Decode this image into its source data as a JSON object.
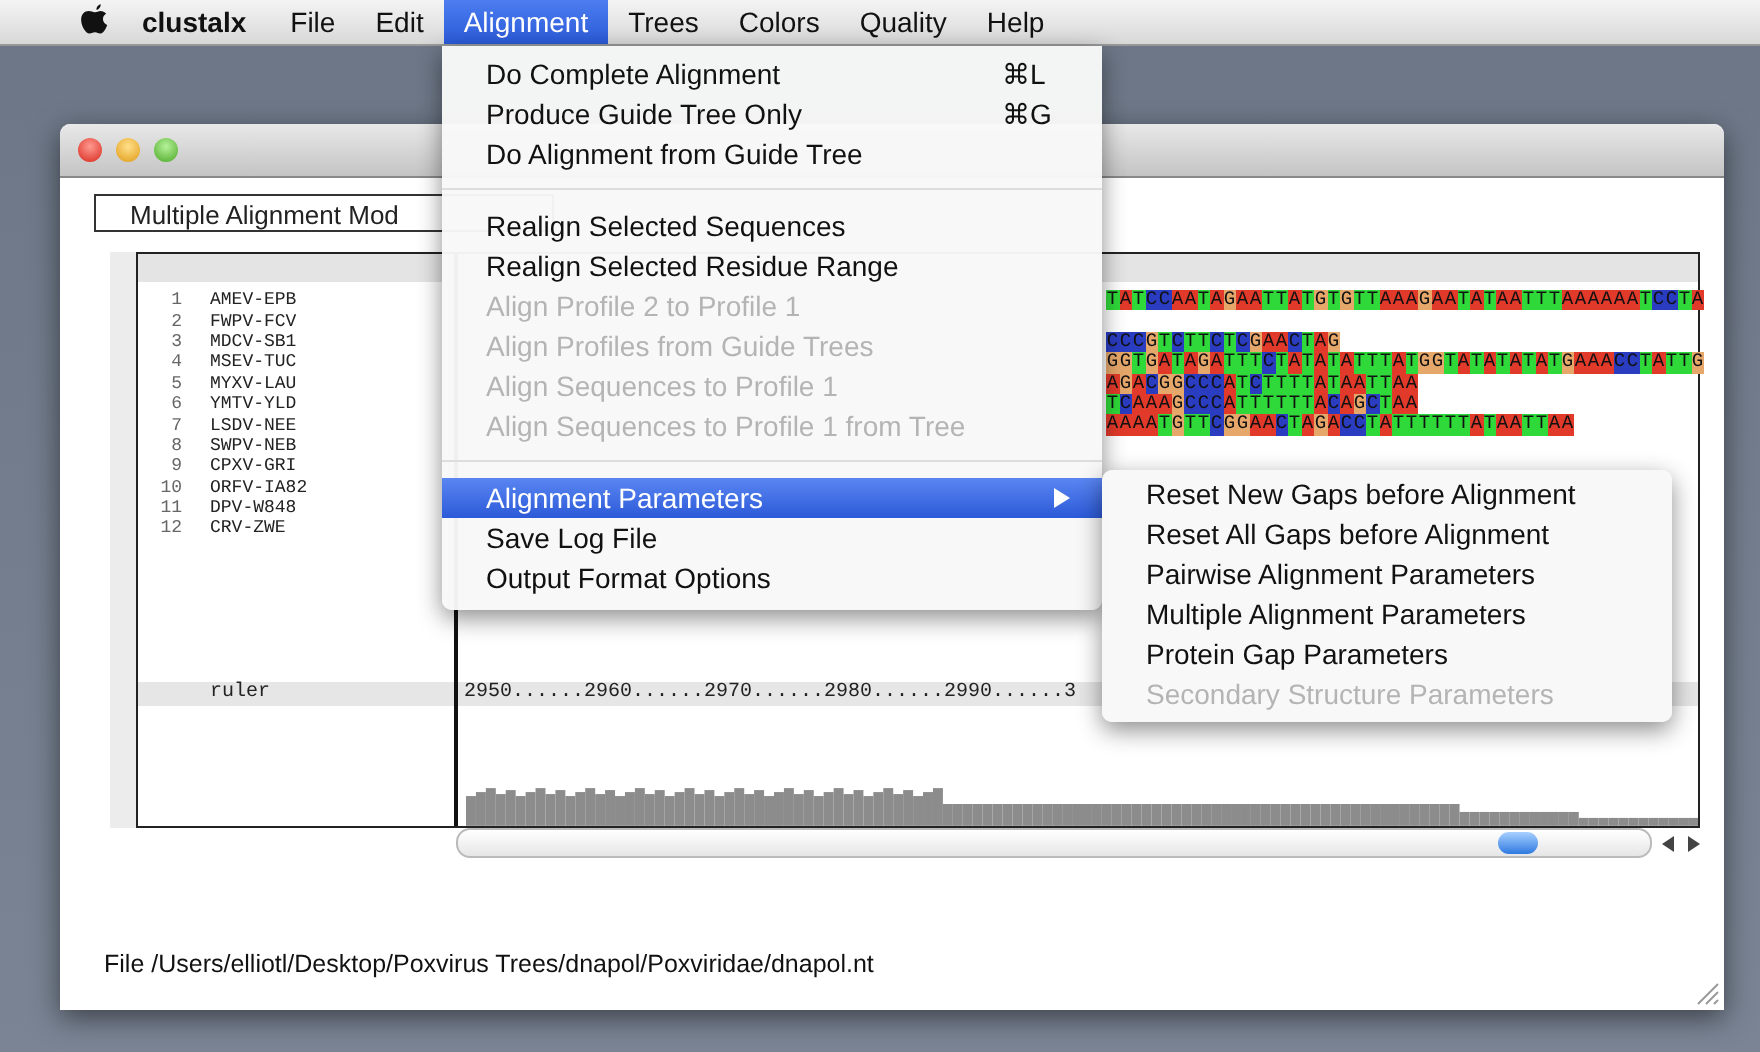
{
  "menu_bar": {
    "app_name": "clustalx",
    "items": [
      {
        "label": "File",
        "selected": false
      },
      {
        "label": "Edit",
        "selected": false
      },
      {
        "label": "Alignment",
        "selected": true
      },
      {
        "label": "Trees",
        "selected": false
      },
      {
        "label": "Colors",
        "selected": false
      },
      {
        "label": "Quality",
        "selected": false
      },
      {
        "label": "Help",
        "selected": false
      }
    ]
  },
  "window": {
    "mode_dropdown": "Multiple Alignment Mod",
    "rows": [
      {
        "number": "1",
        "name": "AMEV-EPB",
        "sequence": "TATCCAATAGAATTATGTGTTAAAGAATATAATTTAAAAAATCCTA"
      },
      {
        "number": "2",
        "name": "FWPV-FCV"
      },
      {
        "number": "3",
        "name": "MDCV-SB1",
        "sequence": "CCCGTCTTCTCGAACTAG"
      },
      {
        "number": "4",
        "name": "MSEV-TUC",
        "sequence": "GGTGATAGATTTCTATATATTTATGGTATATATATGAAACCTATTG"
      },
      {
        "number": "5",
        "name": "MYXV-LAU",
        "sequence": "AGACGGCCCATCTTTTATAATTAA"
      },
      {
        "number": "6",
        "name": "YMTV-YLD",
        "sequence": "TCAAAGCCCATTTTTTACAGCTAA"
      },
      {
        "number": "7",
        "name": "LSDV-NEE",
        "sequence": "AAAATGTTCGGAACTAGACCTATTTTTTATAATTAA"
      },
      {
        "number": "8",
        "name": "SWPV-NEB"
      },
      {
        "number": "9",
        "name": "CPXV-GRI"
      },
      {
        "number": "10",
        "name": "ORFV-IA82"
      },
      {
        "number": "11",
        "name": "DPV-W848"
      },
      {
        "number": "12",
        "name": "CRV-ZWE"
      }
    ],
    "ruler_label": "ruler",
    "ruler": "2950......2960......2970......2980......2990......3",
    "status": "File /Users/elliotl/Desktop/Poxvirus Trees/dnapol/Poxviridae/dnapol.nt"
  },
  "alignment_menu": {
    "sections": [
      [
        {
          "label": "Do Complete Alignment",
          "shortcut": "⌘L",
          "disabled": false,
          "selected": false,
          "submenu": false
        },
        {
          "label": "Produce Guide Tree Only",
          "shortcut": "⌘G",
          "disabled": false,
          "selected": false,
          "submenu": false
        },
        {
          "label": "Do Alignment from Guide Tree",
          "disabled": false,
          "selected": false,
          "submenu": false
        }
      ],
      [
        {
          "label": "Realign Selected Sequences",
          "disabled": false,
          "selected": false,
          "submenu": false
        },
        {
          "label": "Realign Selected Residue Range",
          "disabled": false,
          "selected": false,
          "submenu": false
        },
        {
          "label": "Align Profile 2 to Profile 1",
          "disabled": true,
          "selected": false,
          "submenu": false
        },
        {
          "label": "Align Profiles from Guide Trees",
          "disabled": true,
          "selected": false,
          "submenu": false
        },
        {
          "label": "Align Sequences to Profile 1",
          "disabled": true,
          "selected": false,
          "submenu": false
        },
        {
          "label": "Align Sequences to Profile 1 from Tree",
          "disabled": true,
          "selected": false,
          "submenu": false
        }
      ],
      [
        {
          "label": "Alignment Parameters",
          "disabled": false,
          "selected": true,
          "submenu": true
        },
        {
          "label": "Save Log File",
          "disabled": false,
          "selected": false,
          "submenu": false
        },
        {
          "label": "Output Format Options",
          "disabled": false,
          "selected": false,
          "submenu": false
        }
      ]
    ]
  },
  "submenu": {
    "items": [
      {
        "label": "Reset New Gaps before Alignment",
        "disabled": false
      },
      {
        "label": "Reset All Gaps before Alignment",
        "disabled": false
      },
      {
        "label": "Pairwise Alignment Parameters",
        "disabled": false
      },
      {
        "label": "Multiple Alignment Parameters",
        "disabled": false
      },
      {
        "label": "Protein Gap Parameters",
        "disabled": false
      },
      {
        "label": "Secondary Structure Parameters",
        "disabled": true
      }
    ]
  }
}
